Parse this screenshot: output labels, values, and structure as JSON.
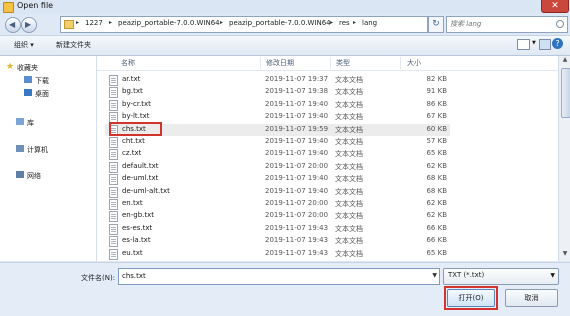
{
  "window": {
    "title": "Open file",
    "close_glyph": "✕"
  },
  "address": {
    "crumbs": [
      "1227",
      "peazip_portable-7.0.0.WIN64",
      "peazip_portable-7.0.0.WIN64",
      "res",
      "lang"
    ],
    "sep": "▸"
  },
  "search": {
    "placeholder": "搜索 lang"
  },
  "toolbar": {
    "organize": "组织 ▾",
    "new_folder": "新建文件夹",
    "help": "?"
  },
  "sidebar": {
    "favorites": "收藏夹",
    "downloads": "下载",
    "desktop": "桌面",
    "library": "库",
    "computer": "计算机",
    "network": "网络"
  },
  "columns": {
    "name": "名称",
    "date": "修改日期",
    "type": "类型",
    "size": "大小"
  },
  "files": [
    {
      "name": "ar.txt",
      "date": "2019-11-07 19:37",
      "type": "文本文档",
      "size": "82 KB"
    },
    {
      "name": "bg.txt",
      "date": "2019-11-07 19:38",
      "type": "文本文档",
      "size": "91 KB"
    },
    {
      "name": "by-cr.txt",
      "date": "2019-11-07 19:40",
      "type": "文本文档",
      "size": "86 KB"
    },
    {
      "name": "by-lt.txt",
      "date": "2019-11-07 19:40",
      "type": "文本文档",
      "size": "67 KB"
    },
    {
      "name": "chs.txt",
      "date": "2019-11-07 19:59",
      "type": "文本文档",
      "size": "60 KB"
    },
    {
      "name": "cht.txt",
      "date": "2019-11-07 19:40",
      "type": "文本文档",
      "size": "57 KB"
    },
    {
      "name": "cz.txt",
      "date": "2019-11-07 19:40",
      "type": "文本文档",
      "size": "65 KB"
    },
    {
      "name": "default.txt",
      "date": "2019-11-07 20:00",
      "type": "文本文档",
      "size": "62 KB"
    },
    {
      "name": "de-uml.txt",
      "date": "2019-11-07 19:40",
      "type": "文本文档",
      "size": "68 KB"
    },
    {
      "name": "de-uml-alt.txt",
      "date": "2019-11-07 19:40",
      "type": "文本文档",
      "size": "68 KB"
    },
    {
      "name": "en.txt",
      "date": "2019-11-07 20:00",
      "type": "文本文档",
      "size": "62 KB"
    },
    {
      "name": "en-gb.txt",
      "date": "2019-11-07 20:00",
      "type": "文本文档",
      "size": "62 KB"
    },
    {
      "name": "es-es.txt",
      "date": "2019-11-07 19:43",
      "type": "文本文档",
      "size": "66 KB"
    },
    {
      "name": "es-la.txt",
      "date": "2019-11-07 19:43",
      "type": "文本文档",
      "size": "66 KB"
    },
    {
      "name": "eu.txt",
      "date": "2019-11-07 19:43",
      "type": "文本文档",
      "size": "65 KB"
    }
  ],
  "bottom": {
    "filename_label": "文件名(N):",
    "filename_value": "chs.txt",
    "filetype": "TXT (*.txt)",
    "open": "打开(O)",
    "cancel": "取消"
  }
}
